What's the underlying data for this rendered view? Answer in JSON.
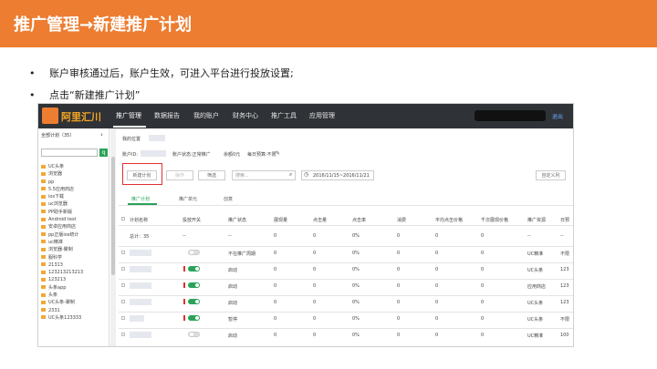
{
  "slide": {
    "title": "推广管理→新建推广计划",
    "bullets": [
      "账户审核通过后，账户生效，可进入平台进行投放设置;",
      "点击“新建推广计划”"
    ],
    "bullet_mark": "•",
    "accent": "#ED7D31"
  },
  "app": {
    "logo": "阿里汇川",
    "nav": [
      "推广管理",
      "数据报告",
      "我的账户",
      "财务中心",
      "推广工具",
      "应用管理"
    ],
    "exit": "退出",
    "sidebar": {
      "header": "全部计划（35）",
      "collapse": "‹",
      "search_icon": "search-icon",
      "items": [
        "UC头条",
        "浏览器",
        "pp",
        "5.5应用商店",
        "ios下载",
        "uc浏览器",
        "PP助手新版",
        "Android test",
        "安卓应用商店",
        "pp正版ios统计",
        "uc精准",
        "浏览器-聚制",
        "服科学",
        "21313",
        "123213213213",
        "123213",
        "头条app",
        "头条",
        "UC头条-聚制",
        "2331",
        "UC头条123333"
      ]
    },
    "main": {
      "breadcrumb": "我的位置",
      "account_id_label": "账户ID:",
      "account_status": "账户状态:正常推广",
      "balance": "余额0元",
      "daily_budget": "每日预算:不限",
      "new_plan_btn": "新建计划",
      "disabled_btn": "操作",
      "filter_btn": "筛选",
      "search_placeholder": "搜索...",
      "date_range": "2016/11/15~2016/11/21",
      "customize_btn": "自定义列",
      "tabs": [
        "推广计划",
        "推广单元",
        "创意"
      ],
      "columns": [
        "计划名称",
        "投放开关",
        "推广状态",
        "展现量",
        "点击量",
        "点击率",
        "消费",
        "平均点击价格",
        "千次展现价格",
        "推广资源",
        "日预"
      ],
      "total_row": [
        "总计：35",
        "--",
        "--",
        "0",
        "0",
        "0%",
        "0",
        "0",
        "0",
        "--",
        "--"
      ],
      "rows": [
        {
          "status": "不在推广周期",
          "imp": "0",
          "clk": "0",
          "ctr": "0%",
          "cost": "0",
          "cpc": "0",
          "cpm": "0",
          "res": "UC精准",
          "budget": "不限"
        },
        {
          "status": "启动",
          "imp": "0",
          "clk": "0",
          "ctr": "0%",
          "cost": "0",
          "cpc": "0",
          "cpm": "0",
          "res": "UC头条",
          "budget": "123"
        },
        {
          "status": "启动",
          "imp": "0",
          "clk": "0",
          "ctr": "0%",
          "cost": "0",
          "cpc": "0",
          "cpm": "0",
          "res": "应用商店",
          "budget": "123"
        },
        {
          "status": "启动",
          "imp": "0",
          "clk": "0",
          "ctr": "0%",
          "cost": "0",
          "cpc": "0",
          "cpm": "0",
          "res": "UC头条",
          "budget": "123"
        },
        {
          "status": "暂停",
          "imp": "0",
          "clk": "0",
          "ctr": "0%",
          "cost": "0",
          "cpc": "0",
          "cpm": "0",
          "res": "UC头条",
          "budget": "不限"
        },
        {
          "status": "启动",
          "imp": "0",
          "clk": "0",
          "ctr": "0%",
          "cost": "0",
          "cpc": "0",
          "cpm": "0",
          "res": "UC精准",
          "budget": "100"
        }
      ]
    }
  }
}
